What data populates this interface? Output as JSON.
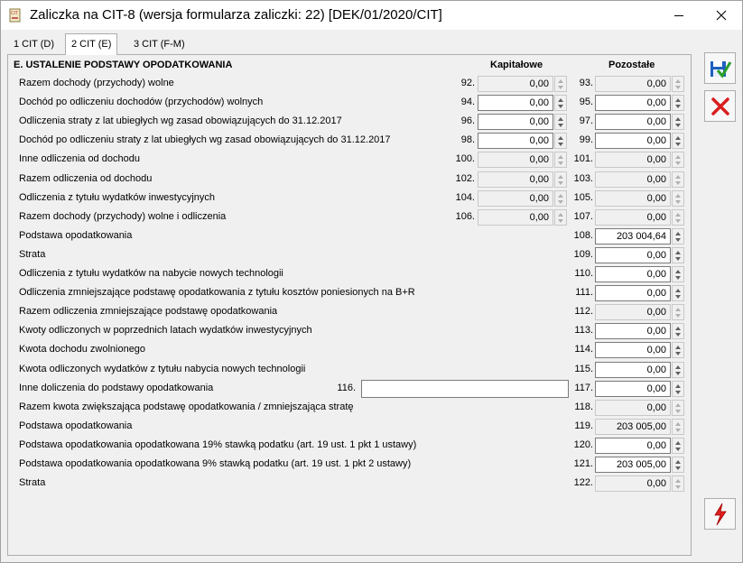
{
  "window": {
    "title": "Zaliczka na CIT-8 (wersja formularza zaliczki: 22) [DEK/01/2020/CIT]"
  },
  "tabs": [
    {
      "label": "1 CIT (D)"
    },
    {
      "label": "2 CIT (E)"
    },
    {
      "label": "3 CIT (F-M)"
    }
  ],
  "section": {
    "title": "E. USTALENIE PODSTAWY OPODATKOWANIA",
    "col_kapitalowe": "Kapitałowe",
    "col_pozostale": "Pozostałe"
  },
  "rows": [
    {
      "label": "Razem dochody (przychody) wolne",
      "n1": "92.",
      "v1": "0,00",
      "n2": "93.",
      "v2": "0,00"
    },
    {
      "label": "Dochód po odliczeniu dochodów (przychodów) wolnych",
      "n1": "94.",
      "v1": "0,00",
      "n2": "95.",
      "v2": "0,00"
    },
    {
      "label": "Odliczenia straty z lat ubiegłych wg zasad obowiązujących do 31.12.2017",
      "n1": "96.",
      "v1": "0,00",
      "n2": "97.",
      "v2": "0,00"
    },
    {
      "label": "Dochód po odliczeniu straty z lat ubiegłych wg zasad obowiązujących do 31.12.2017",
      "n1": "98.",
      "v1": "0,00",
      "n2": "99.",
      "v2": "0,00"
    },
    {
      "label": "Inne odliczenia od dochodu",
      "n1": "100.",
      "v1": "0,00",
      "n2": "101.",
      "v2": "0,00"
    },
    {
      "label": "Razem odliczenia od dochodu",
      "n1": "102.",
      "v1": "0,00",
      "n2": "103.",
      "v2": "0,00"
    },
    {
      "label": "Odliczenia z tytułu wydatków inwestycyjnych",
      "n1": "104.",
      "v1": "0,00",
      "n2": "105.",
      "v2": "0,00"
    },
    {
      "label": "Razem dochody (przychody) wolne i odliczenia",
      "n1": "106.",
      "v1": "0,00",
      "n2": "107.",
      "v2": "0,00"
    },
    {
      "label": "Podstawa opodatkowania",
      "n2": "108.",
      "v2": "203 004,64"
    },
    {
      "label": "Strata",
      "n2": "109.",
      "v2": "0,00"
    },
    {
      "label": "Odliczenia z tytułu wydatków na nabycie nowych technologii",
      "n2": "110.",
      "v2": "0,00"
    },
    {
      "label": "Odliczenia zmniejszające podstawę opodatkowania z tytułu kosztów poniesionych na B+R",
      "n2": "111.",
      "v2": "0,00"
    },
    {
      "label": "Razem odliczenia zmniejszające podstawę opodatkowania",
      "n2": "112.",
      "v2": "0,00"
    },
    {
      "label": "Kwoty odliczonych w poprzednich latach wydatków inwestycyjnych",
      "n2": "113.",
      "v2": "0,00"
    },
    {
      "label": "Kwota dochodu zwolnionego",
      "n2": "114.",
      "v2": "0,00"
    },
    {
      "label": "Kwota odliczonych wydatków z tytułu nabycia nowych technologii",
      "n2": "115.",
      "v2": "0,00"
    },
    {
      "label": "Inne doliczenia do podstawy opodatkowania",
      "n1": "116.",
      "text": "",
      "n2": "117.",
      "v2": "0,00"
    },
    {
      "label": "Razem kwota zwiększająca podstawę opodatkowania / zmniejszająca stratę",
      "n2": "118.",
      "v2": "0,00"
    },
    {
      "label": "Podstawa opodatkowania",
      "n2": "119.",
      "v2": "203 005,00"
    },
    {
      "label": "Podstawa opodatkowania opodatkowana 19% stawką podatku (art. 19 ust. 1 pkt 1 ustawy)",
      "n2": "120.",
      "v2": "0,00"
    },
    {
      "label": "Podstawa opodatkowania opodatkowana 9% stawką podatku (art. 19 ust. 1 pkt 2 ustawy)",
      "n2": "121.",
      "v2": "203 005,00"
    },
    {
      "label": "Strata",
      "n2": "122.",
      "v2": "0,00"
    }
  ],
  "icons": {
    "save": "save-disk-check-icon",
    "cancel": "cancel-x-icon",
    "calculate": "lightning-icon"
  },
  "colors": {
    "save_blue": "#1f5fbf",
    "check_green": "#2aa02a",
    "cancel_red": "#d81e1e",
    "lightning_red": "#e02020"
  }
}
